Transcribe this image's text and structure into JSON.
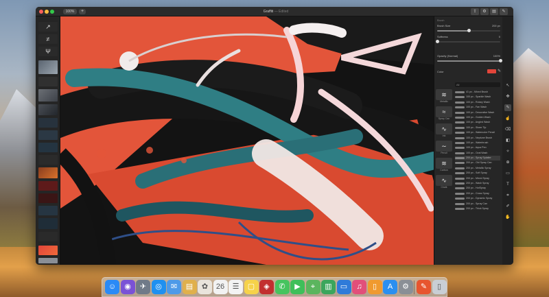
{
  "window": {
    "zoom_label": "100%",
    "add_label": "+",
    "document_title": "Graffiti",
    "document_subtitle": "— Edited"
  },
  "toolbar": {
    "share_icon": "share-icon",
    "settings_icon": "gear-icon",
    "layers_icon": "layers-icon",
    "brush_icon": "brush-icon"
  },
  "panel": {
    "heading": "Brush",
    "brush_size": {
      "label": "Brush Size",
      "value": "200 px",
      "fraction": 0.5
    },
    "softness": {
      "label": "Softness",
      "value": "0",
      "fraction": 0.0
    },
    "opacity": {
      "label": "Opacity (Normal)",
      "value": "100%",
      "fraction": 1.0
    },
    "color_label": "Color",
    "color_hex": "#e2453a",
    "search_placeholder": "All",
    "brush_sets": [
      {
        "label": "Metallic",
        "glyph": "≋"
      },
      {
        "label": "Spray Can",
        "glyph": "≈"
      },
      {
        "label": "Ink",
        "glyph": "∿"
      },
      {
        "label": "Pencil",
        "glyph": "∼"
      },
      {
        "label": "Carbon",
        "glyph": "≋"
      },
      {
        "label": "Chalk",
        "glyph": "∿"
      }
    ],
    "brushes": [
      "41 px - Mixed Brush",
      "100 px - Sparkle Wash",
      "100 px - Rotary Wash",
      "100 px - Fan Wash",
      "100 px - Decorative Wash",
      "100 px - Golden Wash",
      "100 px - Angled Wash",
      "100 px - Sheer Tip",
      "100 px - Watercolor Pencil",
      "100 px - Neptune Brush",
      "100 px - Waterbrush",
      "100 px - Aqua Pen",
      "100 px - Oval Wash",
      "200 px - Spray Splatter",
      "200 px - Old Spray Can",
      "200 px - Metallic Spray",
      "200 px - Soft Spray",
      "200 px - Mixed Spray",
      "200 px - Wash Spray",
      "200 px - HotSpray",
      "200 px - Cross Spray",
      "200 px - Dynamic Spray",
      "200 px - Spray Can",
      "200 px - Thick Spray"
    ],
    "active_brush_index": 13
  },
  "tools": [
    "select-tool-icon",
    "move-tool-icon",
    "brush-tool-icon",
    "smudge-tool-icon",
    "eraser-tool-icon",
    "fill-tool-icon",
    "retouch-tool-icon",
    "clone-tool-icon",
    "shape-tool-icon",
    "text-tool-icon",
    "crop-tool-icon",
    "eyedropper-tool-icon",
    "hand-tool-icon"
  ],
  "dock": [
    {
      "name": "finder-icon",
      "glyph": "☺",
      "color": "#2a8af6"
    },
    {
      "name": "siri-icon",
      "glyph": "◉",
      "color": "#7a52d6"
    },
    {
      "name": "launchpad-icon",
      "glyph": "✈",
      "color": "#707a88"
    },
    {
      "name": "safari-icon",
      "glyph": "◎",
      "color": "#1f90f0"
    },
    {
      "name": "mail-icon",
      "glyph": "✉",
      "color": "#4d9ae8"
    },
    {
      "name": "notes-icon",
      "glyph": "▤",
      "color": "#e0b04c"
    },
    {
      "name": "photos-icon",
      "glyph": "✿",
      "color": "#e9e4dc"
    },
    {
      "name": "calendar-icon",
      "glyph": "26",
      "color": "#f2f2f2"
    },
    {
      "name": "reminders-icon",
      "glyph": "☰",
      "color": "#f3f3f3"
    },
    {
      "name": "stickies-icon",
      "glyph": "▢",
      "color": "#f6d24a"
    },
    {
      "name": "photo-booth-icon",
      "glyph": "◈",
      "color": "#c22f2f"
    },
    {
      "name": "messages-icon",
      "glyph": "✆",
      "color": "#46c45e"
    },
    {
      "name": "facetime-icon",
      "glyph": "▶",
      "color": "#3fbf5a"
    },
    {
      "name": "maps-icon",
      "glyph": "⌖",
      "color": "#5bb55e"
    },
    {
      "name": "numbers-icon",
      "glyph": "▥",
      "color": "#3ba65c"
    },
    {
      "name": "keynote-icon",
      "glyph": "▭",
      "color": "#2f7bd9"
    },
    {
      "name": "itunes-icon",
      "glyph": "♫",
      "color": "#e24f7a"
    },
    {
      "name": "books-icon",
      "glyph": "▯",
      "color": "#f09a2f"
    },
    {
      "name": "app-store-icon",
      "glyph": "A",
      "color": "#2b8ff0"
    },
    {
      "name": "system-preferences-icon",
      "glyph": "⚙",
      "color": "#8a8f96"
    },
    {
      "name": "pixelmator-icon",
      "glyph": "✎",
      "color": "#e7552f"
    },
    {
      "name": "trash-icon",
      "glyph": "▯",
      "color": "#c9ced5"
    }
  ]
}
